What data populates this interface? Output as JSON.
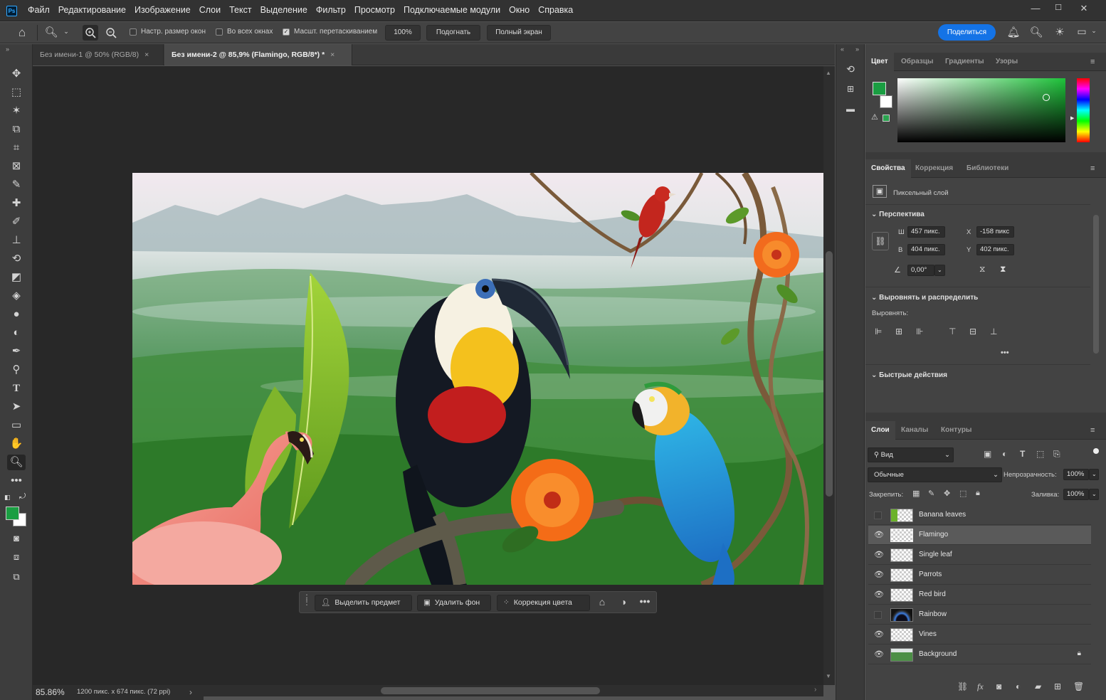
{
  "menubar": {
    "items": [
      "Файл",
      "Редактирование",
      "Изображение",
      "Слои",
      "Текст",
      "Выделение",
      "Фильтр",
      "Просмотр",
      "Подключаемые модули",
      "Окно",
      "Справка"
    ],
    "logo": "Ps"
  },
  "options": {
    "resize_windows": "Настр. размер окон",
    "all_windows": "Во всех окнах",
    "scrubby_zoom": "Масшт. перетаскиванием",
    "zoom_value": "100%",
    "fit_button": "Подогнать",
    "fullscreen_button": "Полный экран",
    "share_button": "Поделиться"
  },
  "tabs": [
    {
      "label": "Без имени-1 @ 50% (RGB/8)",
      "close": "×"
    },
    {
      "label": "Без имени-2 @ 85,9% (Flamingo, RGB/8*) *",
      "close": "×"
    }
  ],
  "status": {
    "zoom": "85.86%",
    "doc_info": "1200 пикс. x 674 пикс. (72 ppi)"
  },
  "taskbar": {
    "select_subject": "Выделить предмет",
    "remove_bg": "Удалить фон",
    "color_correction": "Коррекция цвета"
  },
  "color_panel": {
    "tabs": [
      "Цвет",
      "Образцы",
      "Градиенты",
      "Узоры"
    ],
    "foreground": "#1a9e42",
    "background": "#ffffff"
  },
  "properties_panel": {
    "tabs": [
      "Свойства",
      "Коррекция",
      "Библиотеки"
    ],
    "layer_type": "Пиксельный слой",
    "perspective_title": "Перспектива",
    "w_label": "Ш",
    "w_value": "457 пикс.",
    "h_label": "В",
    "h_value": "404 пикс.",
    "x_label": "X",
    "x_value": "-158 пикс",
    "y_label": "Y",
    "y_value": "402 пикс.",
    "angle_value": "0,00°",
    "align_title": "Выровнять и распределить",
    "align_label": "Выровнять:",
    "quick_actions_title": "Быстрые действия"
  },
  "layers_panel": {
    "tabs": [
      "Слои",
      "Каналы",
      "Контуры"
    ],
    "filter_label": "Вид",
    "blend_mode": "Обычные",
    "opacity_label": "Непрозрачность:",
    "opacity_value": "100%",
    "lock_label": "Закрепить:",
    "fill_label": "Заливка:",
    "fill_value": "100%",
    "layers": [
      {
        "name": "Banana leaves",
        "visible": false,
        "selected": false
      },
      {
        "name": "Flamingo",
        "visible": true,
        "selected": true
      },
      {
        "name": "Single leaf",
        "visible": true,
        "selected": false
      },
      {
        "name": "Parrots",
        "visible": true,
        "selected": false
      },
      {
        "name": "Red bird",
        "visible": true,
        "selected": false
      },
      {
        "name": "Rainbow",
        "visible": false,
        "selected": false
      },
      {
        "name": "Vines",
        "visible": true,
        "selected": false
      },
      {
        "name": "Background",
        "visible": true,
        "selected": false,
        "locked": true
      }
    ]
  }
}
